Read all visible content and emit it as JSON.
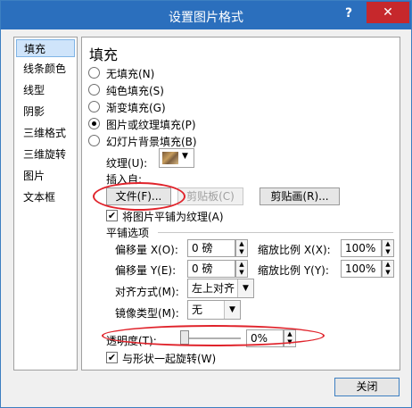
{
  "window": {
    "title": "设置图片格式",
    "help_label": "?",
    "close_label": "✕"
  },
  "sidebar": {
    "items": [
      {
        "label": "填充",
        "selected": true
      },
      {
        "label": "线条颜色"
      },
      {
        "label": "线型"
      },
      {
        "label": "阴影"
      },
      {
        "label": "三维格式"
      },
      {
        "label": "三维旋转"
      },
      {
        "label": "图片"
      },
      {
        "label": "文本框"
      }
    ]
  },
  "fill": {
    "heading": "填充",
    "options": [
      {
        "label": "无填充(N)",
        "checked": false
      },
      {
        "label": "纯色填充(S)",
        "checked": false
      },
      {
        "label": "渐变填充(G)",
        "checked": false
      },
      {
        "label": "图片或纹理填充(P)",
        "checked": true
      },
      {
        "label": "幻灯片背景填充(B)",
        "checked": false
      }
    ],
    "texture_label": "纹理(U):",
    "insert_from_label": "插入自:",
    "file_button": "文件(F)...",
    "clipboard_button": "剪贴板(C)",
    "clipart_button": "剪贴画(R)...",
    "tile_checkbox": "将图片平铺为纹理(A)",
    "tile_checked": true,
    "tiling_options_label": "平铺选项",
    "offset_x_label": "偏移量 X(O):",
    "offset_x_value": "0 磅",
    "scale_x_label": "缩放比例 X(X):",
    "scale_x_value": "100%",
    "offset_y_label": "偏移量 Y(E):",
    "offset_y_value": "0 磅",
    "scale_y_label": "缩放比例 Y(Y):",
    "scale_y_value": "100%",
    "alignment_label": "对齐方式(M):",
    "alignment_value": "左上对齐",
    "mirror_label": "镜像类型(M):",
    "mirror_value": "无",
    "transparency_label": "透明度(T):",
    "transparency_value": "0%",
    "transparency_level": 0,
    "rotate_checkbox": "与形状一起旋转(W)",
    "rotate_checked": true
  },
  "footer": {
    "close_button": "关闭"
  },
  "colors": {
    "titlebar": "#2b6fbd",
    "close_button": "#c6282c",
    "highlight_ellipse": "#e0232b",
    "selection": "#cfe4fa"
  }
}
